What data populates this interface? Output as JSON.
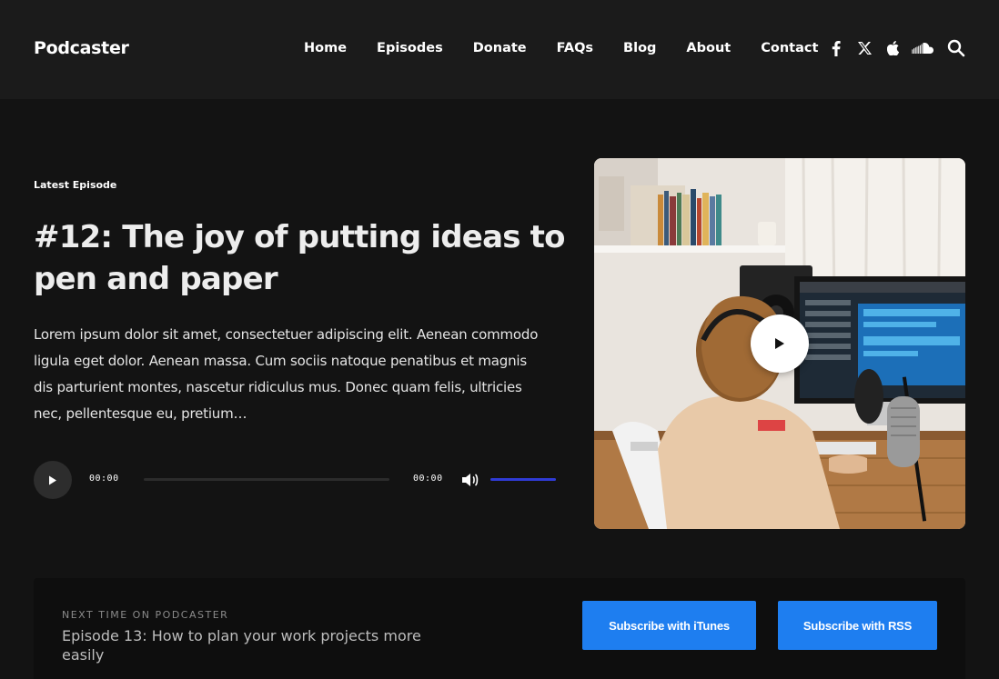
{
  "header": {
    "logo": "Podcaster",
    "nav": [
      "Home",
      "Episodes",
      "Donate",
      "FAQs",
      "Blog",
      "About",
      "Contact"
    ],
    "social_icons": [
      "facebook-icon",
      "x-icon",
      "apple-icon",
      "soundcloud-icon"
    ],
    "search_icon": "search-icon"
  },
  "hero": {
    "eyebrow": "Latest Episode",
    "title": "#12: The joy of putting ideas to pen and paper",
    "description": "Lorem ipsum dolor sit amet, consectetuer adipiscing elit. Aenean commodo ligula eget dolor. Aenean massa. Cum sociis natoque penatibus et magnis dis parturient montes, nascetur ridiculus mus. Donec quam felis, ultricies nec, pellentesque eu, pretium…"
  },
  "player": {
    "current_time": "00:00",
    "duration": "00:00",
    "progress": 0,
    "volume": 1.0,
    "accent_color": "#2f3bd6"
  },
  "next": {
    "label": "NEXT TIME ON PODCASTER",
    "title": "Episode 13: How to plan your work projects more easily",
    "itunes_button": "Subscribe with iTunes",
    "rss_button": "Subscribe with RSS",
    "button_color": "#1e7ef0"
  }
}
